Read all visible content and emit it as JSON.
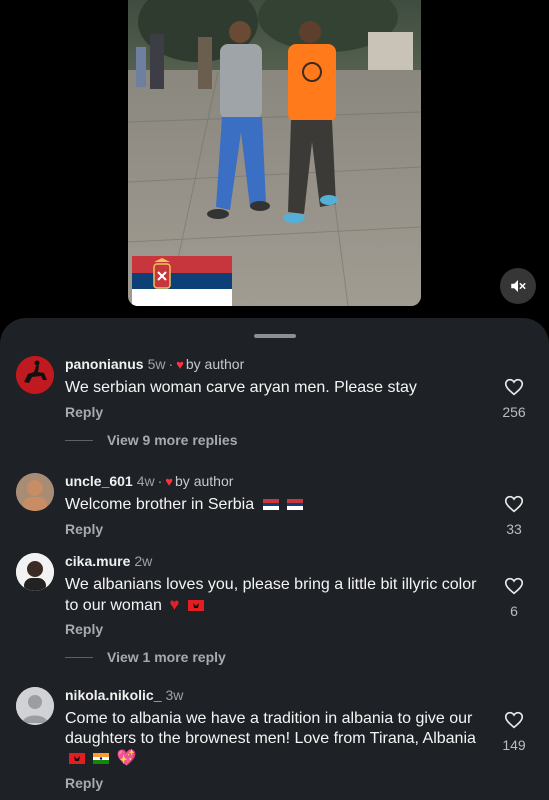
{
  "video": {
    "mute_icon": "speaker-muted-icon",
    "flag_icon": "serbia-flag-icon",
    "flag_colors": [
      "#c6363c",
      "#0c4076",
      "#ffffff"
    ]
  },
  "comments": [
    {
      "username": "panonianus",
      "time": "5w",
      "by_author": "by author",
      "text": "We serbian woman carve aryan men. Please stay",
      "reply_label": "Reply",
      "likes": "256",
      "more_replies": "View 9 more replies"
    },
    {
      "username": "uncle_601",
      "time": "4w",
      "by_author": "by author",
      "text": "Welcome brother in Serbia",
      "reply_label": "Reply",
      "likes": "33"
    },
    {
      "username": "cika.mure",
      "time": "2w",
      "text": "We albanians loves you, please bring a little bit illyric color to our woman",
      "reply_label": "Reply",
      "likes": "6",
      "more_replies": "View 1 more reply"
    },
    {
      "username": "nikola.nikolic_",
      "time": "3w",
      "text": "Come to albania we have a tradition in albania to give our daughters to the brownest men! Love from Tirana, Albania",
      "reply_label": "Reply",
      "likes": "149"
    }
  ],
  "colors": {
    "sheet_bg": "#1e2126",
    "heart_red": "#ff3040",
    "secondary_text": "#a6abb1"
  }
}
